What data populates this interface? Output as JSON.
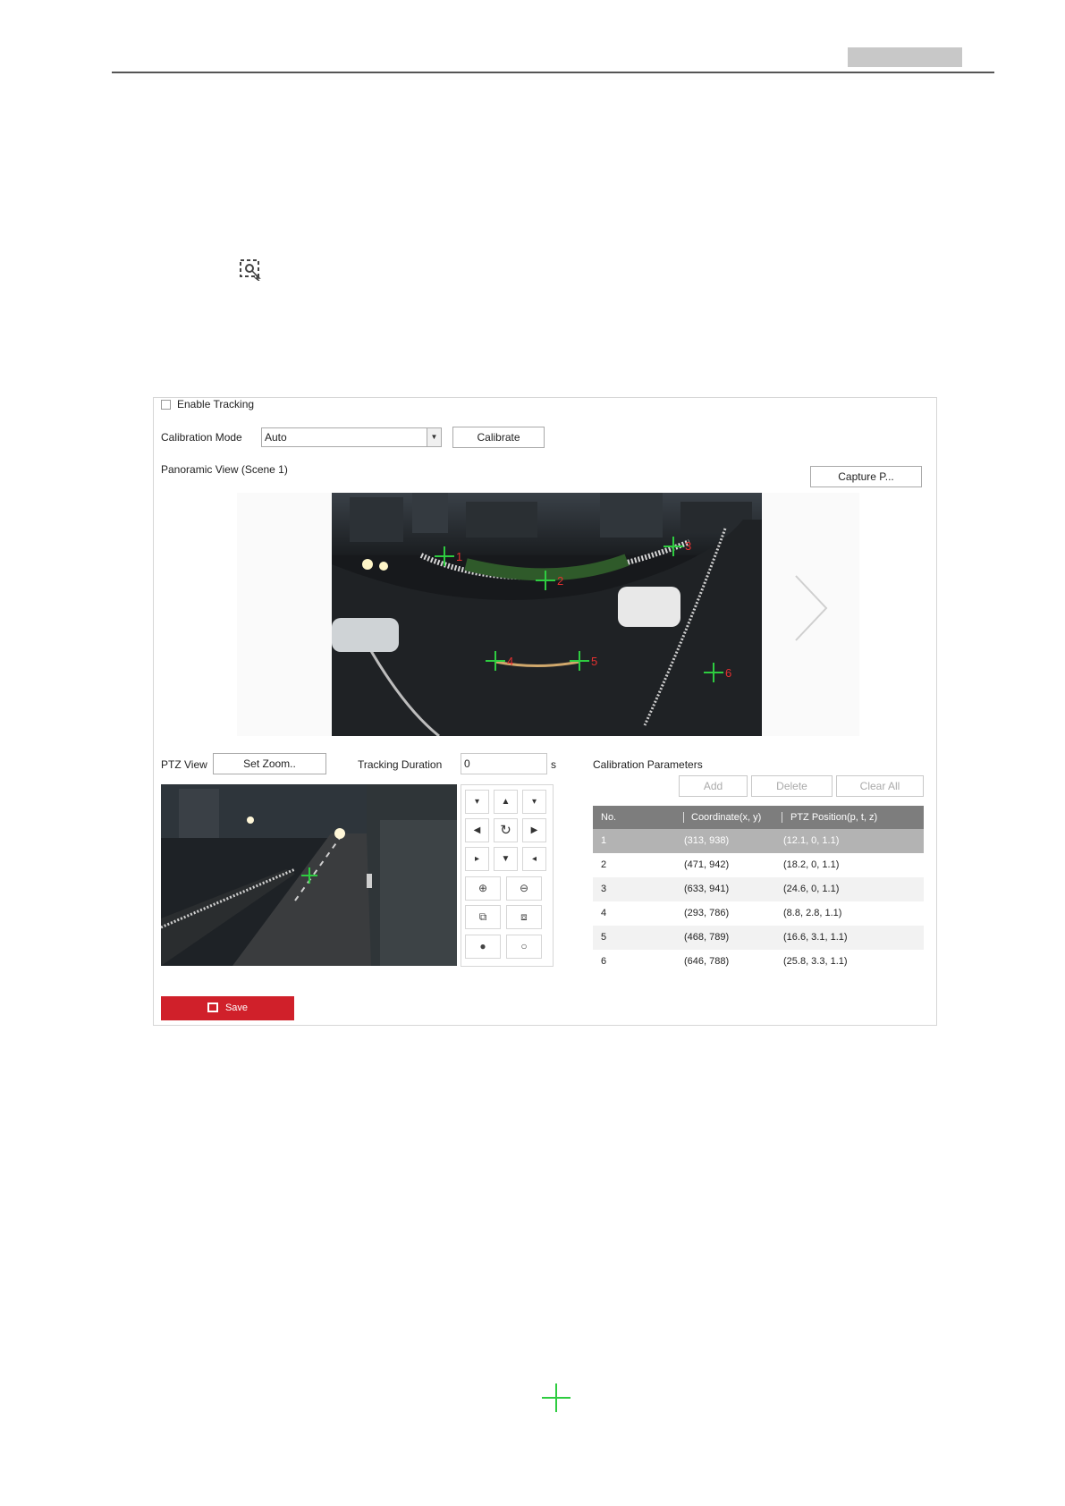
{
  "panel": {
    "enable_tracking_label": "Enable Tracking",
    "enable_tracking_checked": false,
    "calibration_mode_label": "Calibration Mode",
    "calibration_mode_value": "Auto",
    "calibrate_button": "Calibrate",
    "panoramic_view_label": "Panoramic View (Scene 1)",
    "capture_button": "Capture P...",
    "ptz_view_label": "PTZ View",
    "set_zoom_button": "Set Zoom..",
    "tracking_duration_label": "Tracking Duration",
    "tracking_duration_value": "0",
    "tracking_duration_unit": "s",
    "calibration_parameters_label": "Calibration Parameters",
    "add_button": "Add",
    "delete_button": "Delete",
    "clear_all_button": "Clear All",
    "save_button": "Save"
  },
  "calibration_points": [
    "1",
    "2",
    "3",
    "4",
    "5",
    "6"
  ],
  "table": {
    "headers": [
      "No.",
      "Coordinate(x, y)",
      "PTZ Position(p, t, z)"
    ],
    "rows": [
      {
        "no": "1",
        "coord": "(313, 938)",
        "ptz": "(12.1, 0, 1.1)"
      },
      {
        "no": "2",
        "coord": "(471, 942)",
        "ptz": "(18.2, 0, 1.1)"
      },
      {
        "no": "3",
        "coord": "(633, 941)",
        "ptz": "(24.6, 0, 1.1)"
      },
      {
        "no": "4",
        "coord": "(293, 786)",
        "ptz": "(8.8, 2.8, 1.1)"
      },
      {
        "no": "5",
        "coord": "(468, 789)",
        "ptz": "(16.6, 3.1, 1.1)"
      },
      {
        "no": "6",
        "coord": "(646, 788)",
        "ptz": "(25.8, 3.3, 1.1)"
      }
    ],
    "selected_row": 1
  },
  "pad_icons": {
    "up_left": "arrow-up-left-icon",
    "up": "arrow-up-icon",
    "up_right": "arrow-up-right-icon",
    "left": "arrow-left-icon",
    "auto": "auto-scan-icon",
    "right": "arrow-right-icon",
    "down_left": "arrow-down-left-icon",
    "down": "arrow-down-icon",
    "down_right": "arrow-down-right-icon",
    "zoom_in": "zoom-in-icon",
    "zoom_out": "zoom-out-icon",
    "focus_near": "focus-near-icon",
    "focus_far": "focus-far-icon",
    "iris_open": "iris-open-icon",
    "iris_close": "iris-close-icon"
  },
  "colors": {
    "save": "#d0202a",
    "table_header": "#7d7d7d",
    "selected_row": "#b3b3b3",
    "marker_green": "#2ecc40",
    "marker_red": "#e53030"
  }
}
